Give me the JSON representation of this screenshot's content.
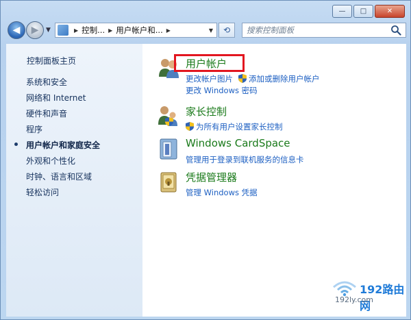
{
  "window": {
    "caption_buttons": {
      "minimize": "—",
      "maximize": "□",
      "close": "✕"
    }
  },
  "navigation": {
    "breadcrumb": [
      "控制...",
      "用户帐户和..."
    ],
    "search_placeholder": "搜索控制面板"
  },
  "sidebar": {
    "home": "控制面板主页",
    "items": [
      {
        "label": "系统和安全"
      },
      {
        "label": "网络和 Internet"
      },
      {
        "label": "硬件和声音"
      },
      {
        "label": "程序"
      },
      {
        "label": "用户帐户和家庭安全",
        "active": true
      },
      {
        "label": "外观和个性化"
      },
      {
        "label": "时钟、语言和区域"
      },
      {
        "label": "轻松访问"
      }
    ]
  },
  "categories": [
    {
      "title": "用户帐户",
      "icon": "user-accounts-icon",
      "links": [
        "更改帐户图片",
        "添加或删除用户帐户",
        "更改 Windows 密码"
      ]
    },
    {
      "title": "家长控制",
      "icon": "parental-controls-icon",
      "links": [
        "为所有用户设置家长控制"
      ]
    },
    {
      "title": "Windows CardSpace",
      "icon": "cardspace-icon",
      "links": [
        "管理用于登录到联机服务的信息卡"
      ]
    },
    {
      "title": "凭据管理器",
      "icon": "credential-manager-icon",
      "links": [
        "管理 Windows 凭据"
      ]
    }
  ],
  "watermark": {
    "title": "192路由网",
    "subtitle": "192ly.com"
  },
  "colors": {
    "highlight": "#e2161f",
    "category_title": "#1a7a1a",
    "link": "#1c5fc2"
  }
}
